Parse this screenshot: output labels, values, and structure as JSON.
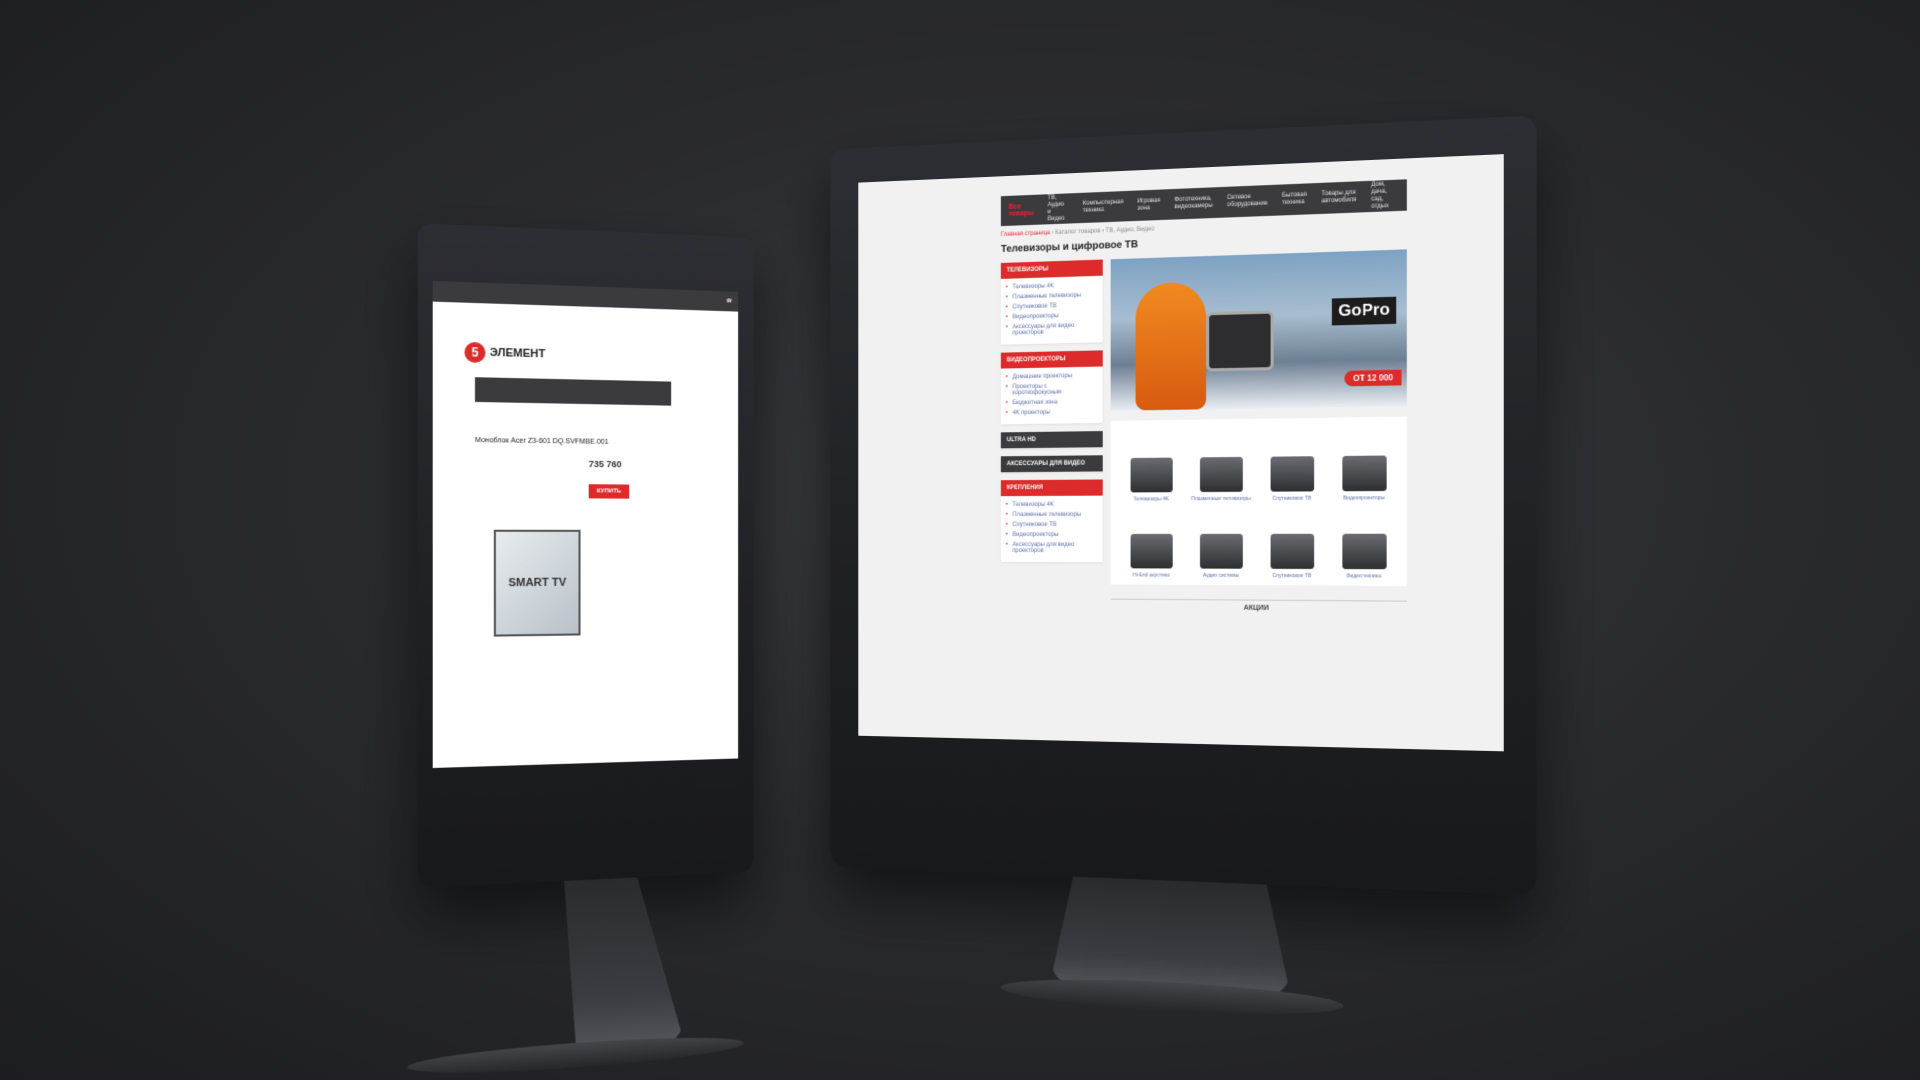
{
  "left_screen": {
    "logo_number": "5",
    "logo_name": "ЭЛЕМЕНТ",
    "product_title": "Моноблок Acer Z3-601 DQ.SVFMBE.001",
    "price": "735 760",
    "buy_label": "КУПИТЬ",
    "promo_label": "SMART TV"
  },
  "right_screen": {
    "nav_catalog": "Все товары",
    "nav_items": [
      "ТВ, Аудио и Видео",
      "Компьютерная техника",
      "Игровая зона",
      "Фототехника, видеокамеры",
      "Сетевое оборудование",
      "Бытовая техника",
      "Товары для автомобиля",
      "Дом, дача, сад, отдых"
    ],
    "breadcrumbs": [
      "Главная страница",
      "Каталог товаров",
      "ТВ, Аудио, Видео"
    ],
    "page_title": "Телевизоры и цифровое ТВ",
    "sidebar": [
      {
        "title": "ТЕЛЕВИЗОРЫ",
        "items": [
          "Телевизоры 4K",
          "Плазменные телевизоры",
          "Спутниковое ТВ",
          "Видеопроекторы",
          "Аксессуары для видео проекторов"
        ]
      },
      {
        "title": "ВИДЕОПРОЕКТОРЫ",
        "items": [
          "Домашние проекторы",
          "Проекторы с короткофокусным",
          "Бюджетная зона",
          "4K проекторы"
        ]
      },
      {
        "title": "ULTRA HD",
        "items": []
      },
      {
        "title": "АКСЕССУАРЫ ДЛЯ ВИДЕО",
        "items": []
      },
      {
        "title": "КРЕПЛЕНИЯ",
        "items": [
          "Телевизоры 4K",
          "Плазменные телевизоры",
          "Спутниковое ТВ",
          "Видеопроекторы",
          "Аксессуары для видео проекторов"
        ]
      }
    ],
    "banner": {
      "brand": "GoPro",
      "price": "ОТ 12 000"
    },
    "tiles": [
      "Телевизоры 4K",
      "Плазменные телевизоры",
      "Спутниковое ТВ",
      "Видеопроекторы",
      "Hi-End акустика",
      "Аудио системы",
      "Спутниковое ТВ",
      "Видеотехника"
    ],
    "footer_section": "АКЦИИ"
  }
}
